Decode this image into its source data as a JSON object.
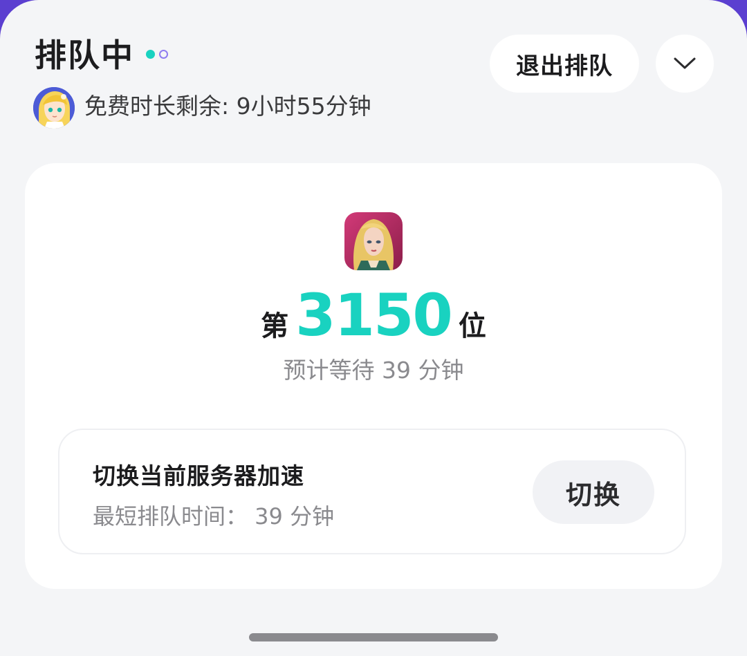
{
  "header": {
    "title": "排队中",
    "exit_label": "退出排队",
    "collapse_icon": "chevron-down-icon",
    "free_time_text": "免费时长剩余: 9小时55分钟"
  },
  "queue": {
    "rank_prefix": "第",
    "rank_number": "3150",
    "rank_suffix": "位",
    "wait_text": "预计等待 39 分钟"
  },
  "switch_server": {
    "title": "切换当前服务器加速",
    "subtitle": "最短排队时间： 39 分钟",
    "button_label": "切换"
  },
  "colors": {
    "accent": "#19d2c0",
    "secondary_dot": "#8e7cf0",
    "background": "#f4f5f7",
    "card": "#ffffff"
  }
}
